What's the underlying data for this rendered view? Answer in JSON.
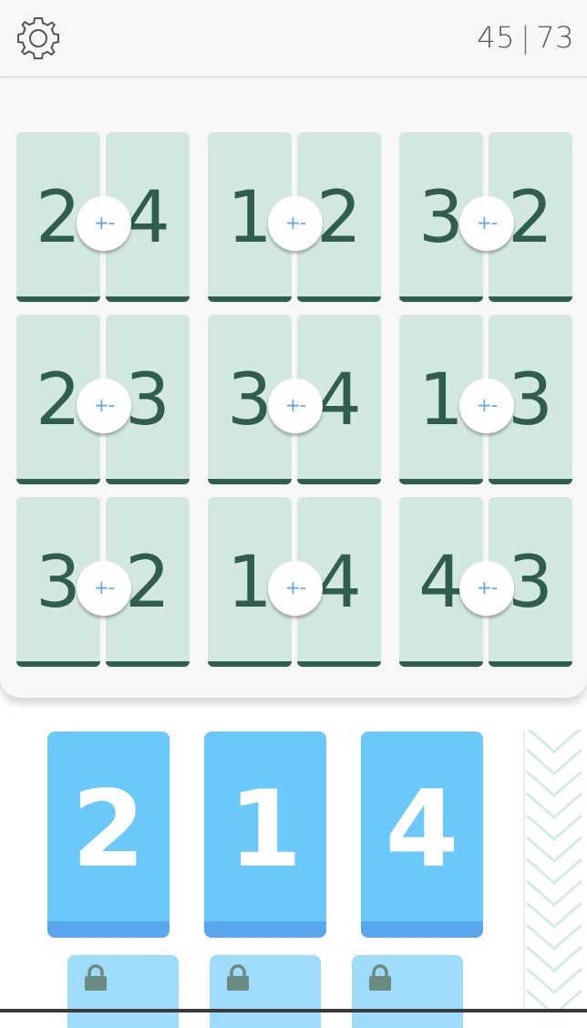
{
  "header": {
    "settings_icon": "gear-icon",
    "score_current": "45",
    "score_separator": "|",
    "score_total": "73"
  },
  "board": {
    "operator_label": "+-",
    "pairs": [
      {
        "left": "2",
        "right": "4"
      },
      {
        "left": "1",
        "right": "2"
      },
      {
        "left": "3",
        "right": "2"
      },
      {
        "left": "2",
        "right": "3"
      },
      {
        "left": "3",
        "right": "4"
      },
      {
        "left": "1",
        "right": "3"
      },
      {
        "left": "3",
        "right": "2"
      },
      {
        "left": "1",
        "right": "4"
      },
      {
        "left": "4",
        "right": "3"
      }
    ]
  },
  "answers": [
    {
      "value": "2"
    },
    {
      "value": "1"
    },
    {
      "value": "4"
    }
  ],
  "locked_answers": [
    {
      "icon": "lock-icon"
    },
    {
      "icon": "lock-icon"
    },
    {
      "icon": "lock-icon"
    }
  ],
  "colors": {
    "tile_bg": "#d2e7e0",
    "tile_text": "#2f5d4e",
    "answer_bg": "#6ac9fa",
    "answer_shadow": "#5aa7ee",
    "operator_text": "#5aa6e6"
  }
}
